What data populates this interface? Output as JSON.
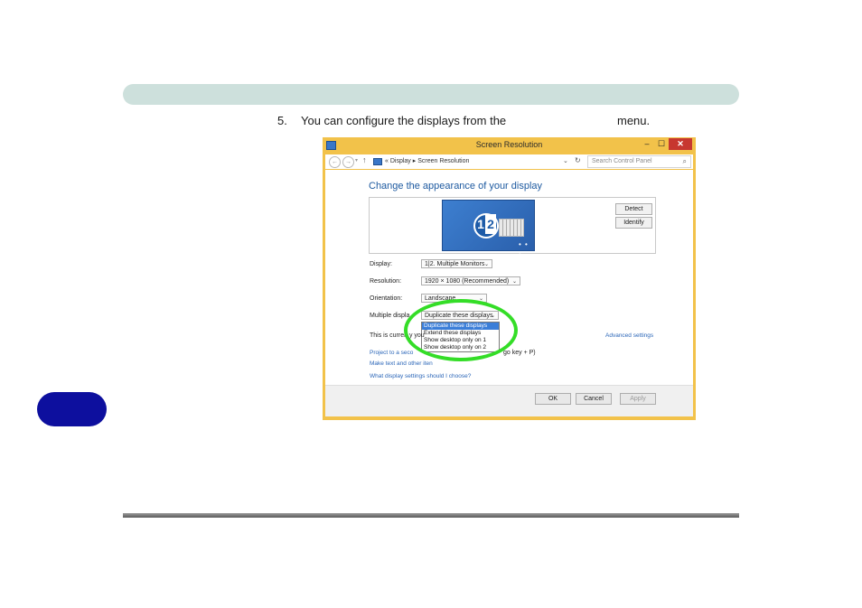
{
  "instruction": {
    "step_number": "5.",
    "text_before": "You can configure the displays from the",
    "text_after": "menu."
  },
  "window": {
    "title": "Screen Resolution",
    "minimize": "–",
    "maximize": "☐",
    "close": "✕",
    "address": {
      "back": "←",
      "forward": "→",
      "up": "↑",
      "crumbs": "« Display ▸ Screen Resolution",
      "search_placeholder": "Search Control Panel",
      "search_icon": "⌕"
    },
    "heading": "Change the appearance of your display",
    "monitor": {
      "num1": "1",
      "num2": "2",
      "dots": "• • •"
    },
    "buttons": {
      "detect": "Detect",
      "identify": "Identify"
    },
    "fields": {
      "display_label": "Display:",
      "display_value": "1|2. Multiple Monitors",
      "resolution_label": "Resolution:",
      "resolution_value": "1920 × 1080 (Recommended)",
      "orientation_label": "Orientation:",
      "orientation_value": "Landscape",
      "multiple_label": "Multiple displa",
      "multiple_value": "Duplicate these displays"
    },
    "dropdown_options": [
      "Duplicate these displays",
      "Extend these displays",
      "Show desktop only on 1",
      "Show desktop only on 2"
    ],
    "links": {
      "current": "This is curren  y you",
      "advanced": "Advanced settings",
      "project": "Project to a seco",
      "project_tail": "go key  + P)",
      "text_size": "Make text and other iten",
      "help": "What display settings should I choose?"
    },
    "footer": {
      "ok": "OK",
      "cancel": "Cancel",
      "apply": "Apply"
    }
  },
  "colors": {
    "header_bar": "#cde0dc",
    "side_tab": "#0d0f9e",
    "window_frame": "#f2c24a",
    "highlight_ring": "#34dd27",
    "link_blue": "#2b66b8"
  }
}
